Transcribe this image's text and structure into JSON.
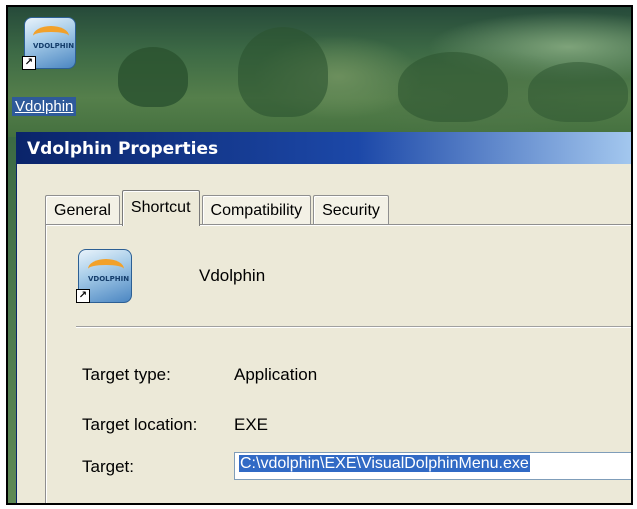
{
  "desktop": {
    "icon_label": "Vdolphin",
    "icon_logo_text": "VDOLPHIN"
  },
  "window": {
    "title": "Vdolphin Properties",
    "tabs": [
      {
        "label": "General",
        "active": false
      },
      {
        "label": "Shortcut",
        "active": true
      },
      {
        "label": "Compatibility",
        "active": false
      },
      {
        "label": "Security",
        "active": false
      }
    ],
    "program_name": "Vdolphin",
    "fields": {
      "target_type": {
        "label": "Target type:",
        "value": "Application"
      },
      "target_location": {
        "label": "Target location:",
        "value": "EXE"
      },
      "target": {
        "label": "Target:",
        "value": "C:\\vdolphin\\EXE\\VisualDolphinMenu.exe"
      }
    }
  },
  "colors": {
    "titlebar_start": "#0a246a",
    "titlebar_end": "#a6caf0",
    "dialog_bg": "#ece9d8",
    "selection": "#316ac5"
  },
  "icons": {
    "program": "vdolphin-app-icon",
    "shortcut_overlay": "shortcut-arrow-icon"
  }
}
